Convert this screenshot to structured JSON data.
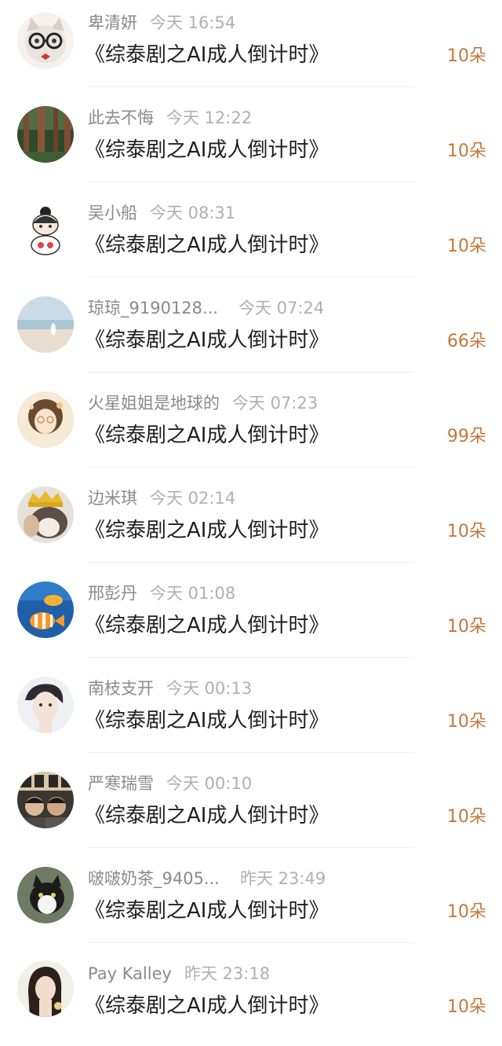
{
  "records": [
    {
      "username": "卑清妍",
      "time": "今天 16:54",
      "title": "《综泰剧之AI成人倒计时》",
      "gift": "10朵",
      "avatar_icon": "cat-with-glasses-avatar"
    },
    {
      "username": "此去不悔",
      "time": "今天 12:22",
      "title": "《综泰剧之AI成人倒计时》",
      "gift": "10朵",
      "avatar_icon": "forest-avatar"
    },
    {
      "username": "吴小船",
      "time": "今天 08:31",
      "title": "《综泰剧之AI成人倒计时》",
      "gift": "10朵",
      "avatar_icon": "cartoon-girl-avatar"
    },
    {
      "username": "琼琼_9190128...",
      "time": "今天 07:24",
      "title": "《综泰剧之AI成人倒计时》",
      "gift": "66朵",
      "avatar_icon": "beach-avatar"
    },
    {
      "username": "火星姐姐是地球的",
      "time": "今天 07:23",
      "title": "《综泰剧之AI成人倒计时》",
      "gift": "99朵",
      "avatar_icon": "illustrated-girl-avatar"
    },
    {
      "username": "边米琪",
      "time": "今天 02:14",
      "title": "《综泰剧之AI成人倒计时》",
      "gift": "10朵",
      "avatar_icon": "dog-with-crown-avatar"
    },
    {
      "username": "邢彭丹",
      "time": "今天 01:08",
      "title": "《综泰剧之AI成人倒计时》",
      "gift": "10朵",
      "avatar_icon": "tropical-fish-avatar"
    },
    {
      "username": "南枝支开",
      "time": "今天 00:13",
      "title": "《综泰剧之AI成人倒计时》",
      "gift": "10朵",
      "avatar_icon": "young-man-portrait-avatar"
    },
    {
      "username": "严寒瑞雪",
      "time": "今天 00:10",
      "title": "《综泰剧之AI成人倒计时》",
      "gift": "10朵",
      "avatar_icon": "group-photo-avatar"
    },
    {
      "username": "啵啵奶茶_9405...",
      "time": "昨天 23:49",
      "title": "《综泰剧之AI成人倒计时》",
      "gift": "10朵",
      "avatar_icon": "black-white-cat-avatar"
    },
    {
      "username": "Pay Kalley",
      "time": "昨天 23:18",
      "title": "《综泰剧之AI成人倒计时》",
      "gift": "10朵",
      "avatar_icon": "woman-portrait-avatar"
    }
  ],
  "colors": {
    "username": "#8a8a8a",
    "time": "#b0b0b0",
    "title": "#1f1f1f",
    "gift": "#c4773a",
    "divider": "#efefef"
  }
}
